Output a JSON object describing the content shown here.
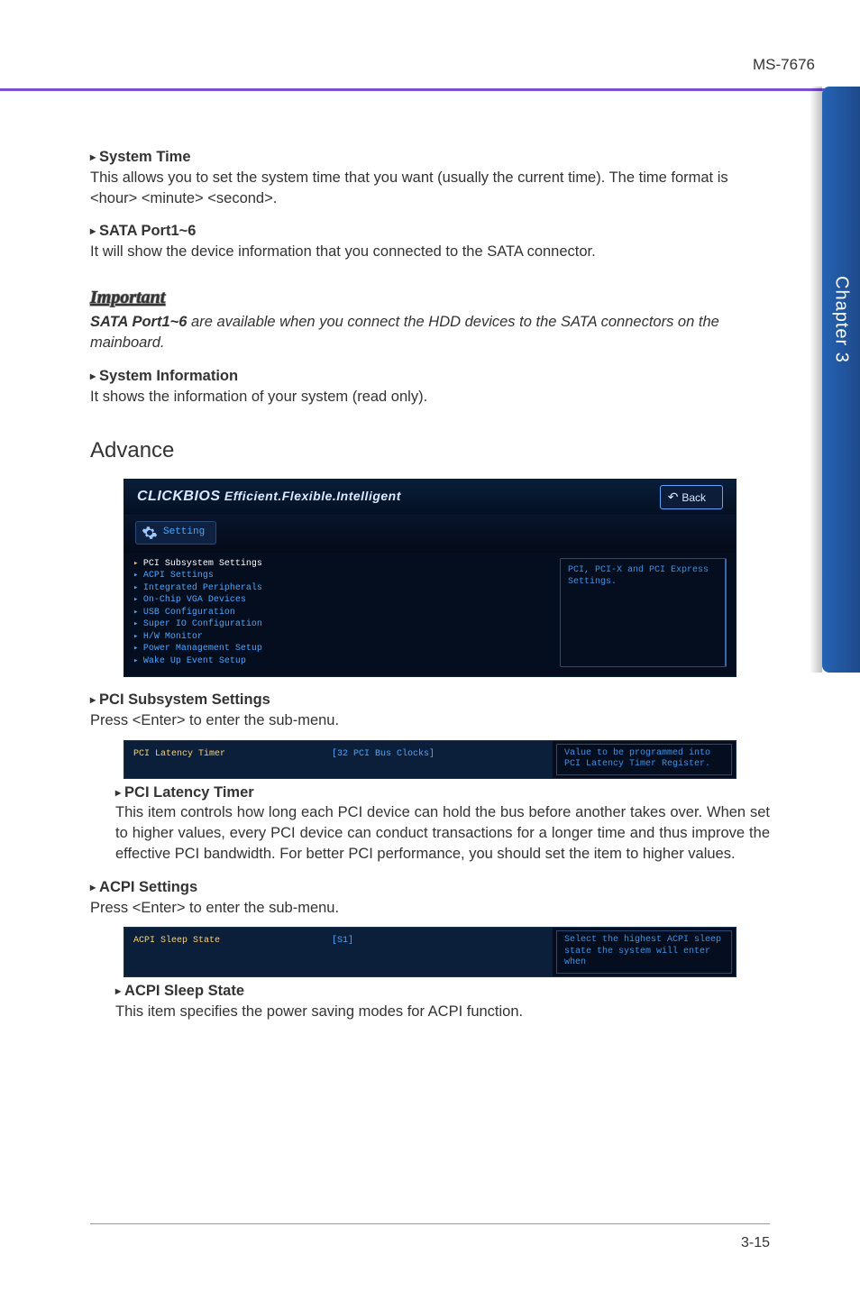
{
  "header": {
    "doc_id": "MS-7676"
  },
  "side_tab": {
    "label": "Chapter 3"
  },
  "sections": {
    "system_time": {
      "title": "System Time",
      "body": "This allows you to set the system time that you want (usually the current time). The time format is <hour> <minute> <second>."
    },
    "sata_port": {
      "title": "SATA Port1~6",
      "body": "It will show the device information that you connected to the SATA connector."
    },
    "important": {
      "label": "Important",
      "bold": "SATA Port1~6",
      "rest": " are available when you connect the HDD devices to the SATA connectors on the mainboard."
    },
    "system_info": {
      "title": "System Information",
      "body": "It shows the information of your system (read only)."
    },
    "advance_heading": "Advance",
    "pci_sub": {
      "title": "PCI Subsystem Settings",
      "body": "Press <Enter> to enter the sub-menu."
    },
    "pci_lat": {
      "title": "PCI Latency Timer",
      "body": "This item controls how long each PCI device can hold the bus before another takes over. When set to higher values, every PCI device can conduct transactions for a longer time and thus improve the effective PCI bandwidth. For better PCI performance, you should set the item to higher values."
    },
    "acpi_settings": {
      "title": "ACPI Settings",
      "body": "Press <Enter> to enter the sub-menu."
    },
    "acpi_sleep": {
      "title": "ACPI Sleep State",
      "body": "This item specifies the power saving modes for ACPI function."
    }
  },
  "bios_main": {
    "logo_brand": "CLICKBIOS",
    "logo_tag": " Efficient.Flexible.Intelligent",
    "back": "Back",
    "setting_chip": "Setting",
    "left_items": [
      "PCI Subsystem Settings",
      "ACPI Settings",
      "Integrated Peripherals",
      "On-Chip VGA Devices",
      "USB Configuration",
      "Super IO Configuration",
      "H/W Monitor",
      "Power Management Setup",
      "Wake Up Event Setup"
    ],
    "right_help": "PCI, PCI-X and PCI Express Settings."
  },
  "bios_strip_pci": {
    "col1": "PCI Latency Timer",
    "col2": "[32 PCI Bus Clocks]",
    "col3": "Value to be programmed into PCI Latency Timer Register."
  },
  "bios_strip_acpi": {
    "col1": "ACPI Sleep State",
    "col2": "[S1]",
    "col3": "Select the highest ACPI sleep state the system will enter when"
  },
  "footer": {
    "page": "3-15"
  }
}
